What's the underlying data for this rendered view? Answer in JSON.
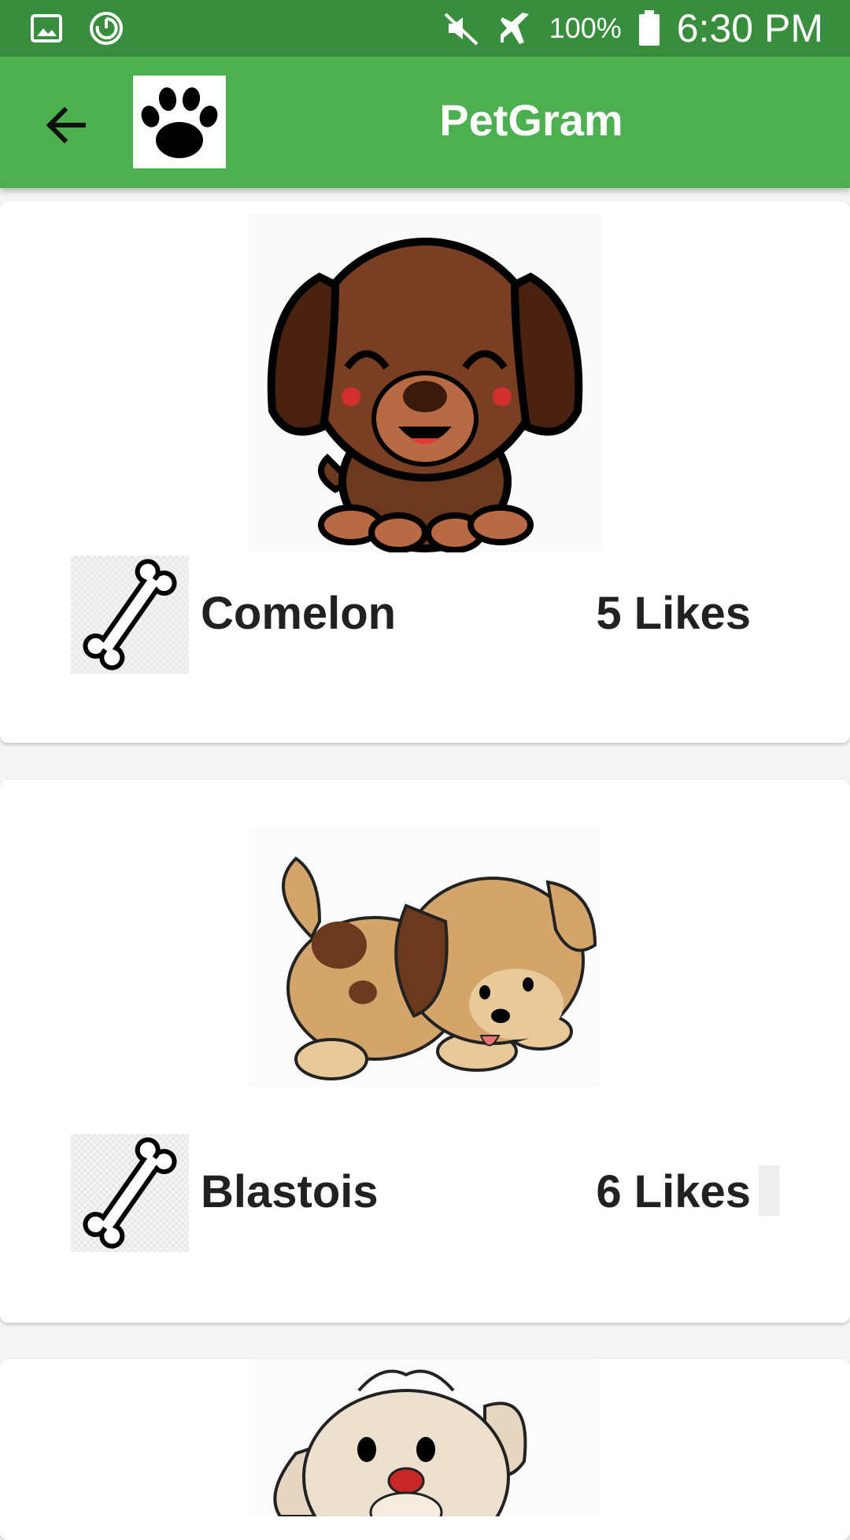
{
  "status_bar": {
    "battery_percent": "100%",
    "time": "6:30 PM",
    "icons": [
      "image-icon",
      "sync-icon",
      "mute-icon",
      "airplane-icon",
      "battery-icon"
    ]
  },
  "app_bar": {
    "title": "PetGram",
    "icons": [
      "back-arrow-icon",
      "paw-icon"
    ],
    "color": "#4caf50",
    "status_color": "#388e3c"
  },
  "feed": {
    "cards": [
      {
        "name": "Comelon",
        "likes": "5 Likes",
        "image": "brown-puppy-image",
        "like_icon": "bone-icon"
      },
      {
        "name": "Blastois",
        "likes": "6 Likes",
        "image": "spotted-puppy-image",
        "like_icon": "bone-icon"
      },
      {
        "name": "",
        "likes": "",
        "image": "fluffy-puppy-image",
        "like_icon": "bone-icon"
      }
    ]
  }
}
